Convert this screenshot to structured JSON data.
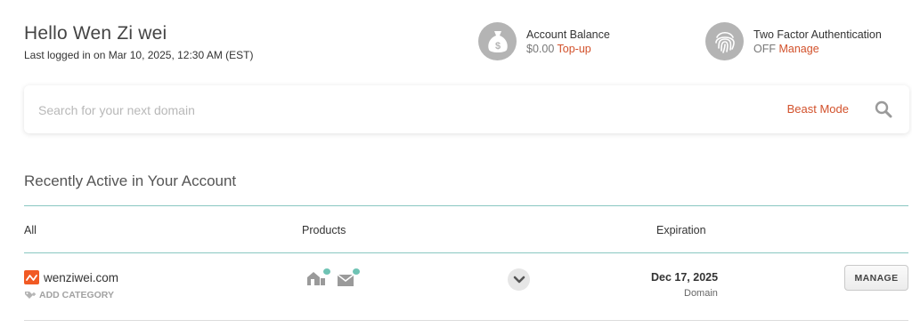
{
  "header": {
    "greeting": "Hello Wen Zi wei",
    "last_login": "Last logged in on Mar 10, 2025, 12:30 AM (EST)"
  },
  "account_balance": {
    "title": "Account Balance",
    "value": "$0.00",
    "action": "Top-up",
    "icon": "money-bag-icon"
  },
  "two_factor": {
    "title": "Two Factor Authentication",
    "status": "OFF",
    "action": "Manage",
    "icon": "fingerprint-icon"
  },
  "search": {
    "placeholder": "Search for your next domain",
    "beast_mode": "Beast Mode"
  },
  "recent": {
    "title": "Recently Active in Your Account",
    "columns": {
      "all": "All",
      "products": "Products",
      "expiration": "Expiration"
    },
    "rows": [
      {
        "domain": "wenziwei.com",
        "add_category": "ADD CATEGORY",
        "products": [
          "hosting-icon",
          "email-icon"
        ],
        "expiration_date": "Dec 17, 2025",
        "expiration_type": "Domain",
        "manage_label": "MANAGE"
      }
    ]
  },
  "colors": {
    "accent": "#d2512b",
    "teal_rule": "#89c7c1",
    "icon_circle": "#b4b4b4",
    "brand_orange": "#f15a24",
    "badge_teal": "#6fc3b4"
  }
}
